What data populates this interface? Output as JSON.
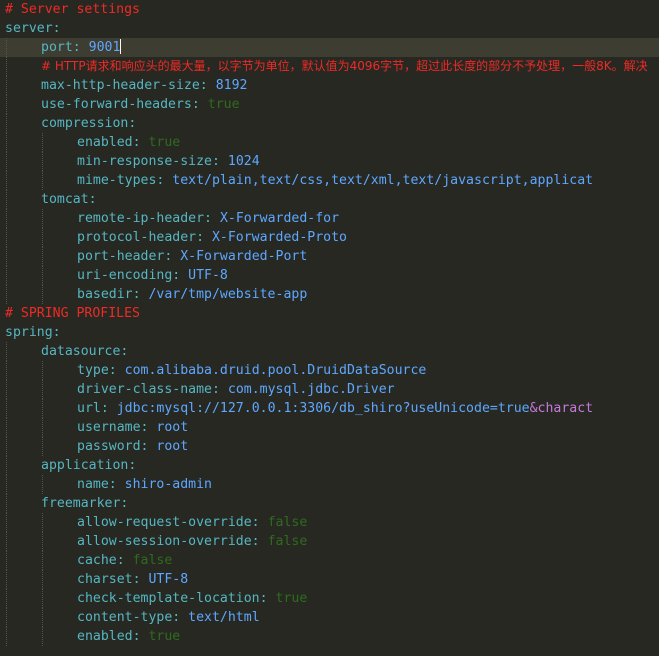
{
  "editor": {
    "language": "yaml",
    "colors": {
      "background": "#272822",
      "comment": "#ef2a26",
      "key": "#56b6c2",
      "value": "#5ea7ff",
      "boolean": "#2f6b1f",
      "special": "#c678dd",
      "current_line": "#3e3d32"
    },
    "lines": [
      {
        "indent": 0,
        "type": "comment",
        "text": "# Server settings"
      },
      {
        "indent": 0,
        "type": "key",
        "key": "server"
      },
      {
        "indent": 1,
        "type": "kv",
        "key": "port",
        "value": "9001",
        "vtype": "num",
        "current": true,
        "caret": true
      },
      {
        "indent": 1,
        "type": "comment",
        "text": "# HTTP请求和响应头的最大量，以字节为单位，默认值为4096字节，超过此长度的部分不予处理，一般8K。解决"
      },
      {
        "indent": 1,
        "type": "kv",
        "key": "max-http-header-size",
        "value": "8192",
        "vtype": "num"
      },
      {
        "indent": 1,
        "type": "kv",
        "key": "use-forward-headers",
        "value": "true",
        "vtype": "bool"
      },
      {
        "indent": 1,
        "type": "key",
        "key": "compression"
      },
      {
        "indent": 2,
        "type": "kv",
        "key": "enabled",
        "value": "true",
        "vtype": "bool"
      },
      {
        "indent": 2,
        "type": "kv",
        "key": "min-response-size",
        "value": "1024",
        "vtype": "num"
      },
      {
        "indent": 2,
        "type": "kv",
        "key": "mime-types",
        "value": "text/plain,text/css,text/xml,text/javascript,applicat",
        "vtype": "str"
      },
      {
        "indent": 1,
        "type": "key",
        "key": "tomcat"
      },
      {
        "indent": 2,
        "type": "kv",
        "key": "remote-ip-header",
        "value": "X-Forwarded-for",
        "vtype": "str"
      },
      {
        "indent": 2,
        "type": "kv",
        "key": "protocol-header",
        "value": "X-Forwarded-Proto",
        "vtype": "str"
      },
      {
        "indent": 2,
        "type": "kv",
        "key": "port-header",
        "value": "X-Forwarded-Port",
        "vtype": "str"
      },
      {
        "indent": 2,
        "type": "kv",
        "key": "uri-encoding",
        "value": "UTF-8",
        "vtype": "str"
      },
      {
        "indent": 2,
        "type": "kv",
        "key": "basedir",
        "value": "/var/tmp/website-app",
        "vtype": "str"
      },
      {
        "indent": 0,
        "type": "comment",
        "text": "# SPRING PROFILES"
      },
      {
        "indent": 0,
        "type": "key",
        "key": "spring"
      },
      {
        "indent": 1,
        "type": "key",
        "key": "datasource"
      },
      {
        "indent": 2,
        "type": "kv",
        "key": "type",
        "value": "com.alibaba.druid.pool.DruidDataSource",
        "vtype": "str"
      },
      {
        "indent": 2,
        "type": "kv",
        "key": "driver-class-name",
        "value": "com.mysql.jdbc.Driver",
        "vtype": "str"
      },
      {
        "indent": 2,
        "type": "kv",
        "key": "url",
        "value": "jdbc:mysql://127.0.0.1:3306/db_shiro?useUnicode=true",
        "value_special": "&charact",
        "vtype": "str"
      },
      {
        "indent": 2,
        "type": "kv",
        "key": "username",
        "value": "root",
        "vtype": "str"
      },
      {
        "indent": 2,
        "type": "kv",
        "key": "password",
        "value": "root",
        "vtype": "str"
      },
      {
        "indent": 1,
        "type": "key",
        "key": "application"
      },
      {
        "indent": 2,
        "type": "kv",
        "key": "name",
        "value": "shiro-admin",
        "vtype": "str"
      },
      {
        "indent": 1,
        "type": "key",
        "key": "freemarker"
      },
      {
        "indent": 2,
        "type": "kv",
        "key": "allow-request-override",
        "value": "false",
        "vtype": "bool"
      },
      {
        "indent": 2,
        "type": "kv",
        "key": "allow-session-override",
        "value": "false",
        "vtype": "bool"
      },
      {
        "indent": 2,
        "type": "kv",
        "key": "cache",
        "value": "false",
        "vtype": "bool"
      },
      {
        "indent": 2,
        "type": "kv",
        "key": "charset",
        "value": "UTF-8",
        "vtype": "str"
      },
      {
        "indent": 2,
        "type": "kv",
        "key": "check-template-location",
        "value": "true",
        "vtype": "bool"
      },
      {
        "indent": 2,
        "type": "kv",
        "key": "content-type",
        "value": "text/html",
        "vtype": "str"
      },
      {
        "indent": 2,
        "type": "kv",
        "key": "enabled",
        "value": "true",
        "vtype": "bool"
      }
    ]
  }
}
